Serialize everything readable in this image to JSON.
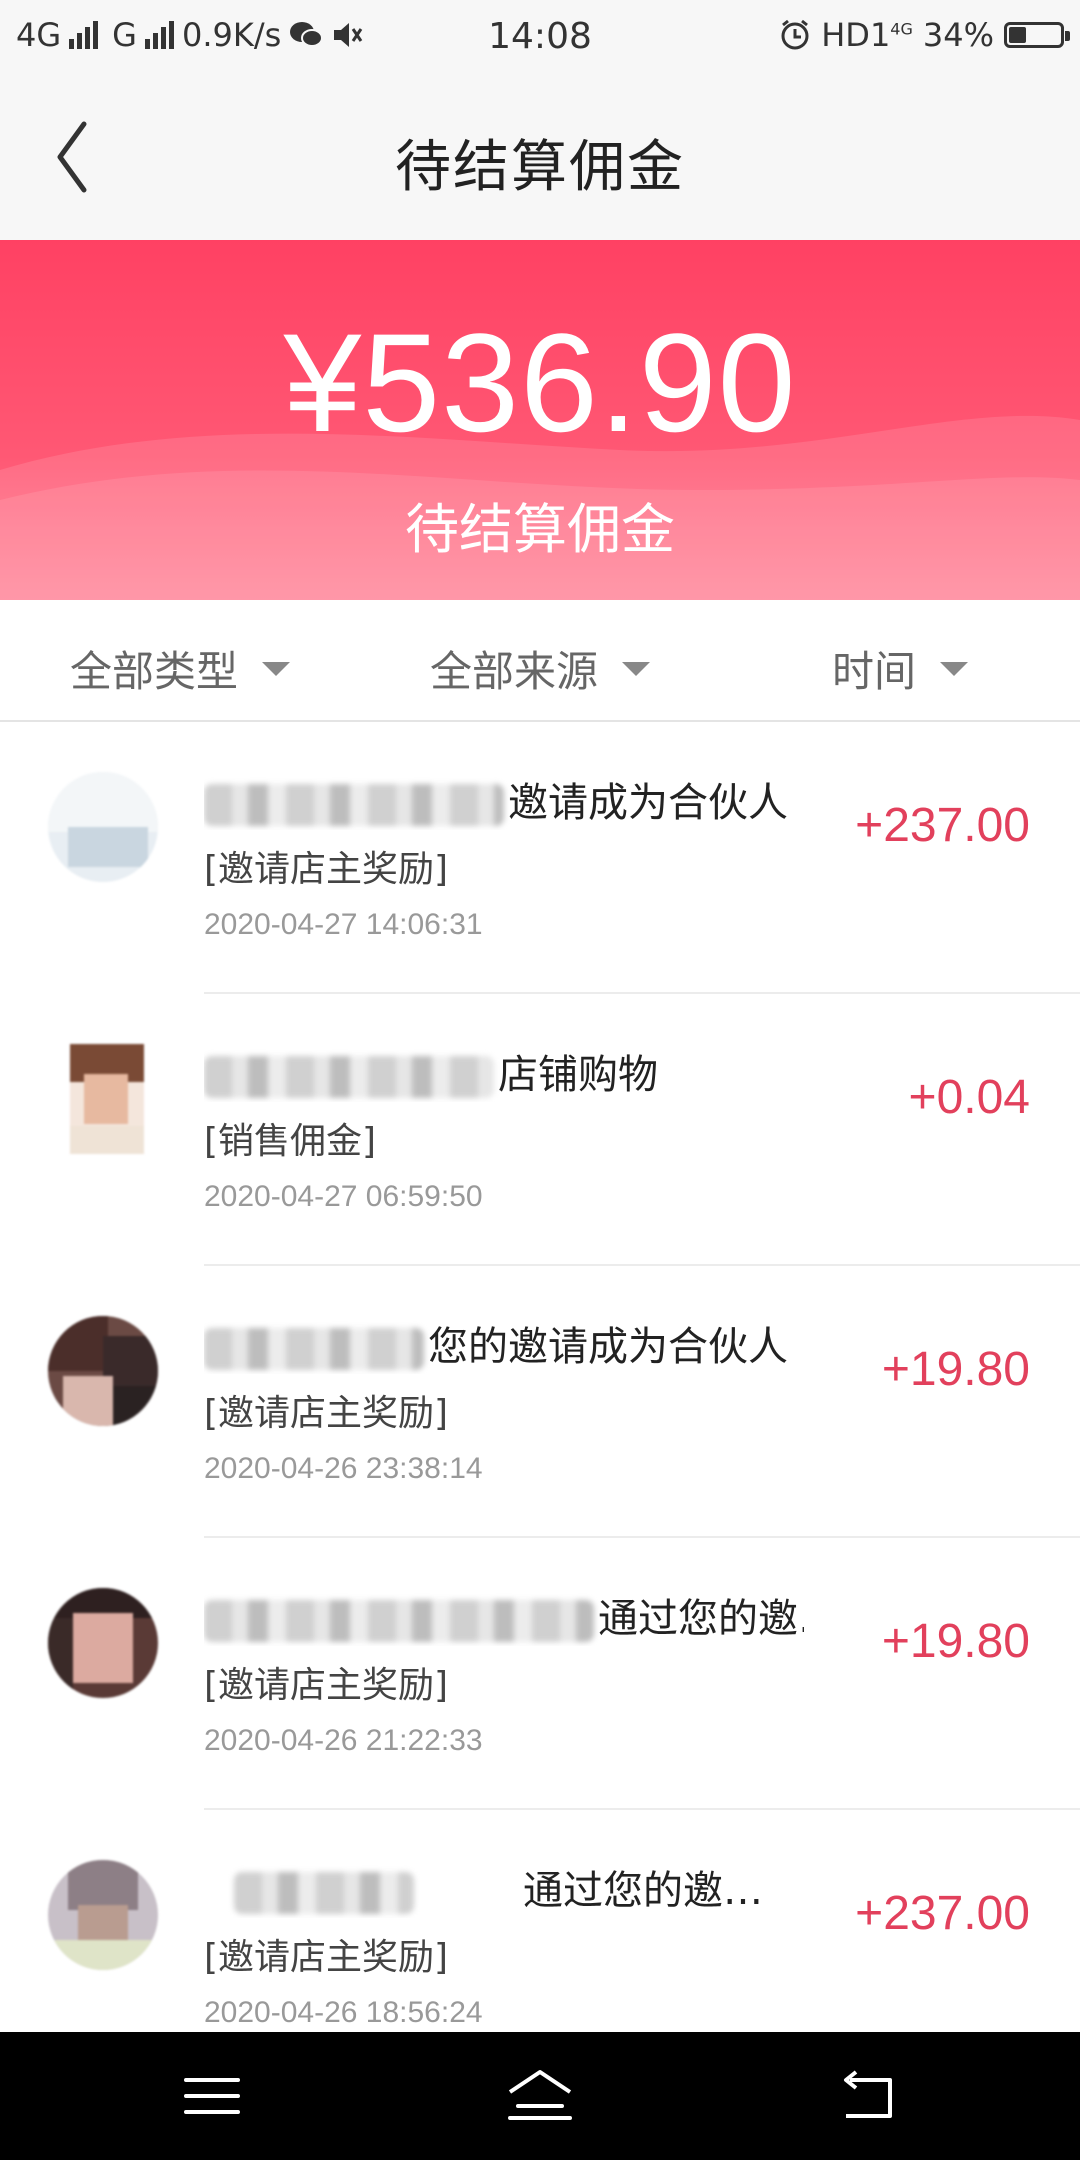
{
  "status_bar": {
    "network_1": "4G",
    "network_2": "G",
    "speed": "0.9K/s",
    "time": "14:08",
    "hd_label": "HD1",
    "hd_sup": "4G",
    "battery_percent": "34%",
    "battery_level": 0.34
  },
  "header": {
    "title": "待结算佣金",
    "back_icon": "chevron-left-icon"
  },
  "summary": {
    "amount": "¥536.90",
    "label": "待结算佣金",
    "colors": {
      "top": "#ff4163",
      "bottom": "#ff7d92"
    }
  },
  "filters": [
    {
      "label": "全部类型"
    },
    {
      "label": "全部来源"
    },
    {
      "label": "时间"
    }
  ],
  "records": [
    {
      "title_suffix": "邀请成为合伙人",
      "type": "[邀请店主奖励]",
      "time": "2020-04-27 14:06:31",
      "amount": "+237.00"
    },
    {
      "title_suffix": "店铺购物",
      "type": "[销售佣金]",
      "time": "2020-04-27 06:59:50",
      "amount": "+0.04"
    },
    {
      "title_suffix": "您的邀请成为合伙人",
      "type": "[邀请店主奖励]",
      "time": "2020-04-26 23:38:14",
      "amount": "+19.80"
    },
    {
      "title_suffix": "通过您的邀…",
      "type": "[邀请店主奖励]",
      "time": "2020-04-26 21:22:33",
      "amount": "+19.80"
    },
    {
      "title_suffix": "通过您的邀…",
      "type": "[邀请店主奖励]",
      "time": "2020-04-26 18:56:24",
      "amount": "+237.00"
    }
  ],
  "accent_color": "#e2405c",
  "navbar": {
    "menu_icon": "menu-icon",
    "home_icon": "home-icon",
    "back_icon": "back-arrow-icon"
  }
}
